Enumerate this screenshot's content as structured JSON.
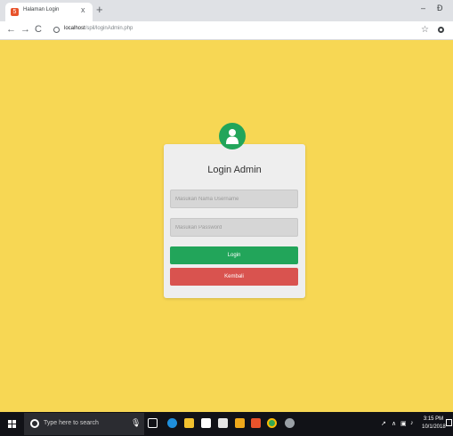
{
  "browser": {
    "tab_title": "Halaman Login",
    "tab_close": "x",
    "new_tab": "+",
    "minimize": "–",
    "restore": "Ɖ",
    "url_host": "localhost",
    "url_path": "/spil/loginAdmin.php",
    "back": "←",
    "forward": "→",
    "reload": "C",
    "star": "☆"
  },
  "login": {
    "title": "Login Admin",
    "username_placeholder": "Masukan Nama Username",
    "password_placeholder": "Masukan Password",
    "login_label": "Login",
    "back_label": "Kembali"
  },
  "taskbar": {
    "search_placeholder": "Type here to search",
    "time": "3:15 PM",
    "date": "10/1/2018",
    "tray_symbols": "∧"
  },
  "colors": {
    "page_background": "#f7d754",
    "accent_green": "#22a55a",
    "danger_red": "#d9534f"
  },
  "icons": [
    "html5-favicon",
    "user-icon",
    "windows-logo",
    "search-circle-icon",
    "microphone-icon",
    "task-view-icon",
    "edge-icon",
    "file-explorer-icon",
    "store-icon",
    "mail-icon",
    "chrome-icon"
  ]
}
